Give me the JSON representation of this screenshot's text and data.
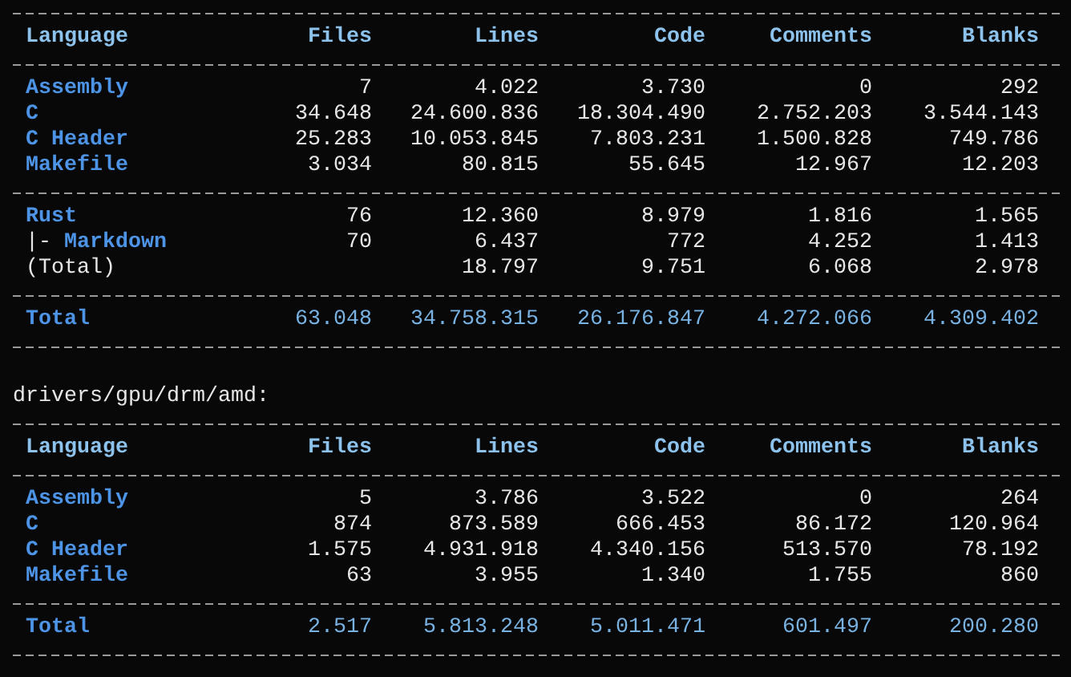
{
  "sections": [
    {
      "columns": [
        "Language",
        "Files",
        "Lines",
        "Code",
        "Comments",
        "Blanks"
      ],
      "groups": [
        [
          {
            "kind": "language",
            "name": "Assembly",
            "files": "7",
            "lines": "4.022",
            "code": "3.730",
            "comments": "0",
            "blanks": "292"
          },
          {
            "kind": "language",
            "name": "C",
            "files": "34.648",
            "lines": "24.600.836",
            "code": "18.304.490",
            "comments": "2.752.203",
            "blanks": "3.544.143"
          },
          {
            "kind": "language",
            "name": "C Header",
            "files": "25.283",
            "lines": "10.053.845",
            "code": "7.803.231",
            "comments": "1.500.828",
            "blanks": "749.786"
          },
          {
            "kind": "language",
            "name": "Makefile",
            "files": "3.034",
            "lines": "80.815",
            "code": "55.645",
            "comments": "12.967",
            "blanks": "12.203"
          }
        ],
        [
          {
            "kind": "language",
            "name": "Rust",
            "files": "76",
            "lines": "12.360",
            "code": "8.979",
            "comments": "1.816",
            "blanks": "1.565"
          },
          {
            "kind": "embedded",
            "branch": "|-",
            "name": "Markdown",
            "files": "70",
            "lines": "6.437",
            "code": "772",
            "comments": "4.252",
            "blanks": "1.413"
          },
          {
            "kind": "subtotal",
            "name": "(Total)",
            "lines": "18.797",
            "code": "9.751",
            "comments": "6.068",
            "blanks": "2.978"
          }
        ]
      ],
      "total": {
        "name": "Total",
        "files": "63.048",
        "lines": "34.758.315",
        "code": "26.176.847",
        "comments": "4.272.066",
        "blanks": "4.309.402"
      }
    },
    {
      "heading": "drivers/gpu/drm/amd:",
      "columns": [
        "Language",
        "Files",
        "Lines",
        "Code",
        "Comments",
        "Blanks"
      ],
      "groups": [
        [
          {
            "kind": "language",
            "name": "Assembly",
            "files": "5",
            "lines": "3.786",
            "code": "3.522",
            "comments": "0",
            "blanks": "264"
          },
          {
            "kind": "language",
            "name": "C",
            "files": "874",
            "lines": "873.589",
            "code": "666.453",
            "comments": "86.172",
            "blanks": "120.964"
          },
          {
            "kind": "language",
            "name": "C Header",
            "files": "1.575",
            "lines": "4.931.918",
            "code": "4.340.156",
            "comments": "513.570",
            "blanks": "78.192"
          },
          {
            "kind": "language",
            "name": "Makefile",
            "files": "63",
            "lines": "3.955",
            "code": "1.340",
            "comments": "1.755",
            "blanks": "860"
          }
        ]
      ],
      "total": {
        "name": "Total",
        "files": "2.517",
        "lines": "5.813.248",
        "code": "5.011.471",
        "comments": "601.497",
        "blanks": "200.280"
      }
    }
  ]
}
